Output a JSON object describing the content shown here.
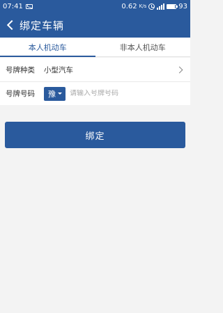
{
  "status_bar": {
    "time": "07:41",
    "network_speed": "0.62",
    "network_speed_unit": "K/s",
    "battery_level": "93",
    "icons": [
      "message-icon",
      "alarm-clock-icon",
      "signal-icon",
      "battery-icon"
    ]
  },
  "header": {
    "title": "绑定车辆",
    "back_icon": "chevron-left-icon"
  },
  "tabs": [
    {
      "label": "本人机动车",
      "active": true
    },
    {
      "label": "非本人机动车",
      "active": false
    }
  ],
  "form": {
    "plate_type": {
      "label": "号牌种类",
      "value": "小型汽车",
      "icon": "chevron-right-icon"
    },
    "plate_number": {
      "label": "号牌号码",
      "province": "豫",
      "placeholder": "请输入号牌号码",
      "value": ""
    }
  },
  "submit_label": "绑定",
  "colors": {
    "primary": "#2a5a9d",
    "background": "#f3f3f3"
  }
}
